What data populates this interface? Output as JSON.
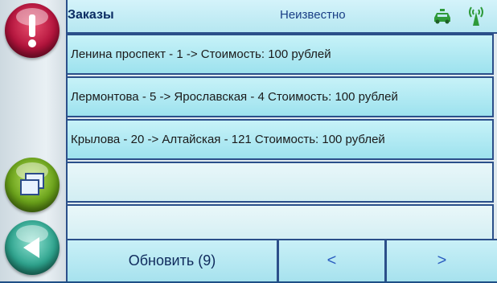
{
  "header": {
    "title": "Заказы",
    "status": "Неизвестно",
    "icons": [
      "taxi-icon",
      "signal-icon"
    ]
  },
  "sidebar": {
    "buttons": [
      {
        "name": "alert-button",
        "icon": "exclamation-icon"
      },
      {
        "name": "windows-button",
        "icon": "windows-icon"
      },
      {
        "name": "back-button",
        "icon": "back-arrow-icon"
      }
    ]
  },
  "orders": [
    {
      "text": "Ленина проспект - 1 ->  Стоимость: 100 рублей"
    },
    {
      "text": "Лермонтова - 5 -> Ярославская - 4 Стоимость: 100 рублей"
    },
    {
      "text": "Крылова - 20 -> Алтайская - 121 Стоимость: 100 рублей"
    },
    {
      "text": ""
    },
    {
      "text": ""
    }
  ],
  "footer": {
    "refresh_label": "Обновить (9)",
    "prev_label": "<",
    "next_label": ">"
  },
  "colors": {
    "accent": "#2b4f8a",
    "row_fill": "#b4ebf3",
    "alert": "#b3133c",
    "windows": "#6aa21a",
    "back": "#2ea48e",
    "taxi": "#2e9a3a"
  }
}
